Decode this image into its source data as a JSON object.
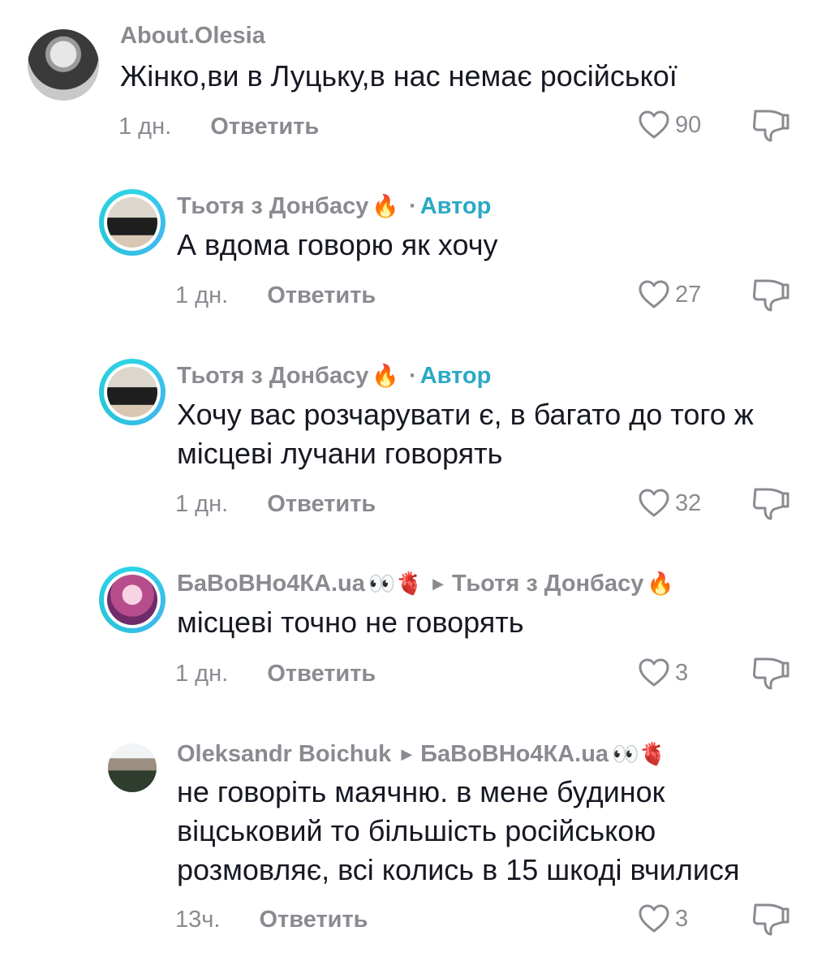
{
  "comments": [
    {
      "username": "About.Olesia",
      "text": "Жінко,ви в Луцьку,в нас немає російської",
      "time": "1 дн.",
      "reply_label": "Ответить",
      "likes": "90"
    },
    {
      "username": "Тьотя з Донбасу",
      "username_emoji": "🔥",
      "separator": "·",
      "badge": "Автор",
      "text": "А вдома говорю як хочу",
      "time": "1 дн.",
      "reply_label": "Ответить",
      "likes": "27"
    },
    {
      "username": "Тьотя з Донбасу",
      "username_emoji": "🔥",
      "separator": "·",
      "badge": "Автор",
      "text": "Хочу вас розчарувати є, в багато до того ж місцеві лучани говорять",
      "time": "1 дн.",
      "reply_label": "Ответить",
      "likes": "32"
    },
    {
      "username": "БаВоВНо4КА.ua",
      "username_emoji": "👀🫀",
      "reply_to": "Тьотя з Донбасу",
      "reply_to_emoji": "🔥",
      "text": "місцеві точно не говорять",
      "time": "1 дн.",
      "reply_label": "Ответить",
      "likes": "3"
    },
    {
      "username": "Oleksandr Boichuk",
      "reply_to": "БаВоВНо4КА.ua",
      "reply_to_emoji": "👀🫀",
      "text": "не говоріть маячню. в мене будинок віцськовий то більшість російською розмовляє, всі колись в 15 шкоді вчилися",
      "time": "13ч.",
      "reply_label": "Ответить",
      "likes": "3"
    }
  ],
  "colors": {
    "text": "#161823",
    "secondary": "#8a8b91",
    "author_badge": "#2aa9c5",
    "story_ring": "#2fd3e6"
  },
  "icons": {
    "like": "heart-outline-icon",
    "dislike": "thumbs-down-outline-icon",
    "reply_arrow": "triangle-right-icon"
  }
}
